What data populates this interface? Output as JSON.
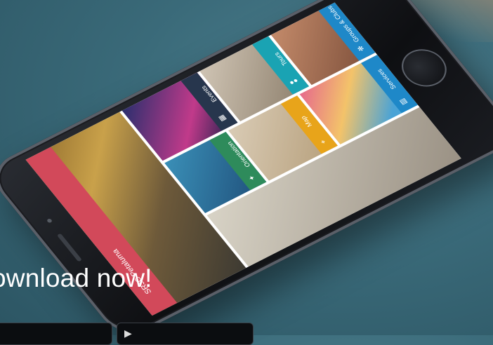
{
  "hero": {
    "title": "SRJC Petaluma"
  },
  "tiles": [
    {
      "label": "Events"
    },
    {
      "label": "Tours"
    },
    {
      "label": "Groups & Clubs"
    },
    {
      "label": "Orientation"
    },
    {
      "label": "Map"
    },
    {
      "label": "Services"
    }
  ],
  "headline": "ownload now!",
  "colors": {
    "hero_bar": "#d2495a",
    "events": "#27364d",
    "tours": "#1aa3b3",
    "groups": "#1e88c8",
    "orientation": "#2e8b5b",
    "map": "#e8a41a",
    "services": "#1e88c8"
  },
  "icons": {
    "events": "calendar-icon",
    "tours": "people-icon",
    "groups": "gear-icon",
    "orientation": "star-icon",
    "map": "pin-icon",
    "services": "book-icon",
    "apple": "apple-icon",
    "google": "play-icon"
  }
}
